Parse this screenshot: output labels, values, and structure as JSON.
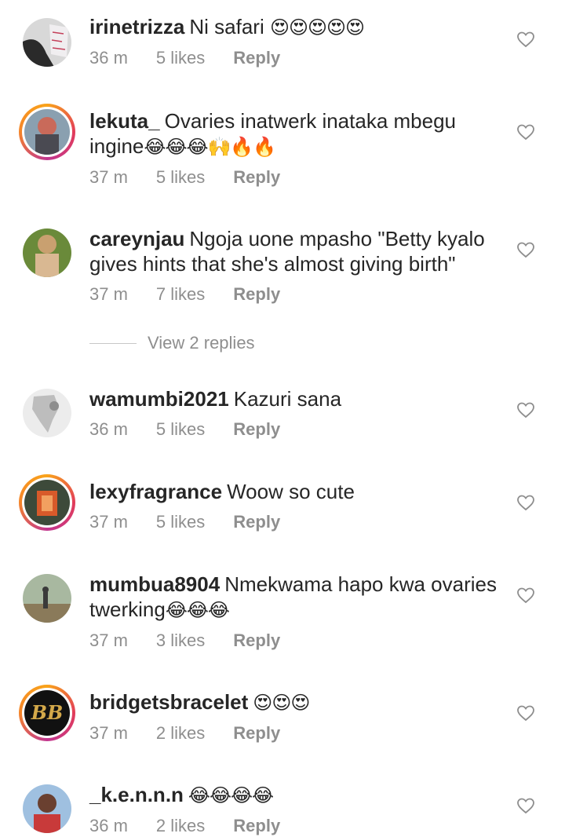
{
  "comments": [
    {
      "username": "irinetrizza",
      "text": "Ni safari",
      "emoji": "😍😍😍😍😍",
      "time": "36 m",
      "likes": "5 likes",
      "reply": "Reply",
      "story_ring": false
    },
    {
      "username": "lekuta_",
      "text": "Ovaries inatwerk inataka mbegu ingine",
      "emoji": "😂😂😂🙌🔥🔥",
      "time": "37 m",
      "likes": "5 likes",
      "reply": "Reply",
      "story_ring": true
    },
    {
      "username": "careynjau",
      "text": "Ngoja uone mpasho \"Betty kyalo gives hints that she's almost giving birth\"",
      "emoji": "",
      "time": "37 m",
      "likes": "7 likes",
      "reply": "Reply",
      "story_ring": false
    },
    {
      "username": "wamumbi2021",
      "text": "Kazuri sana",
      "emoji": "",
      "time": "36 m",
      "likes": "5 likes",
      "reply": "Reply",
      "story_ring": false
    },
    {
      "username": "lexyfragrance",
      "text": "Woow so cute",
      "emoji": "",
      "time": "37 m",
      "likes": "5 likes",
      "reply": "Reply",
      "story_ring": true
    },
    {
      "username": "mumbua8904",
      "text": "Nmekwama hapo kwa ovaries twerking",
      "emoji": "😂😂😂",
      "time": "37 m",
      "likes": "3 likes",
      "reply": "Reply",
      "story_ring": false
    },
    {
      "username": "bridgetsbracelet",
      "text": "",
      "emoji": "😍😍😍",
      "time": "37 m",
      "likes": "2 likes",
      "reply": "Reply",
      "story_ring": true
    },
    {
      "username": "_k.e.n.n.n",
      "text": "",
      "emoji": "😂😂😂😂",
      "time": "36 m",
      "likes": "2 likes",
      "reply": "Reply",
      "story_ring": false
    }
  ],
  "view_replies": "View 2 replies",
  "avatar_text": {
    "bridgets": "BB"
  },
  "colors": {
    "text": "#262626",
    "meta": "#8e8e8e",
    "ring_start": "#f9a31a",
    "ring_end": "#c1358f"
  }
}
